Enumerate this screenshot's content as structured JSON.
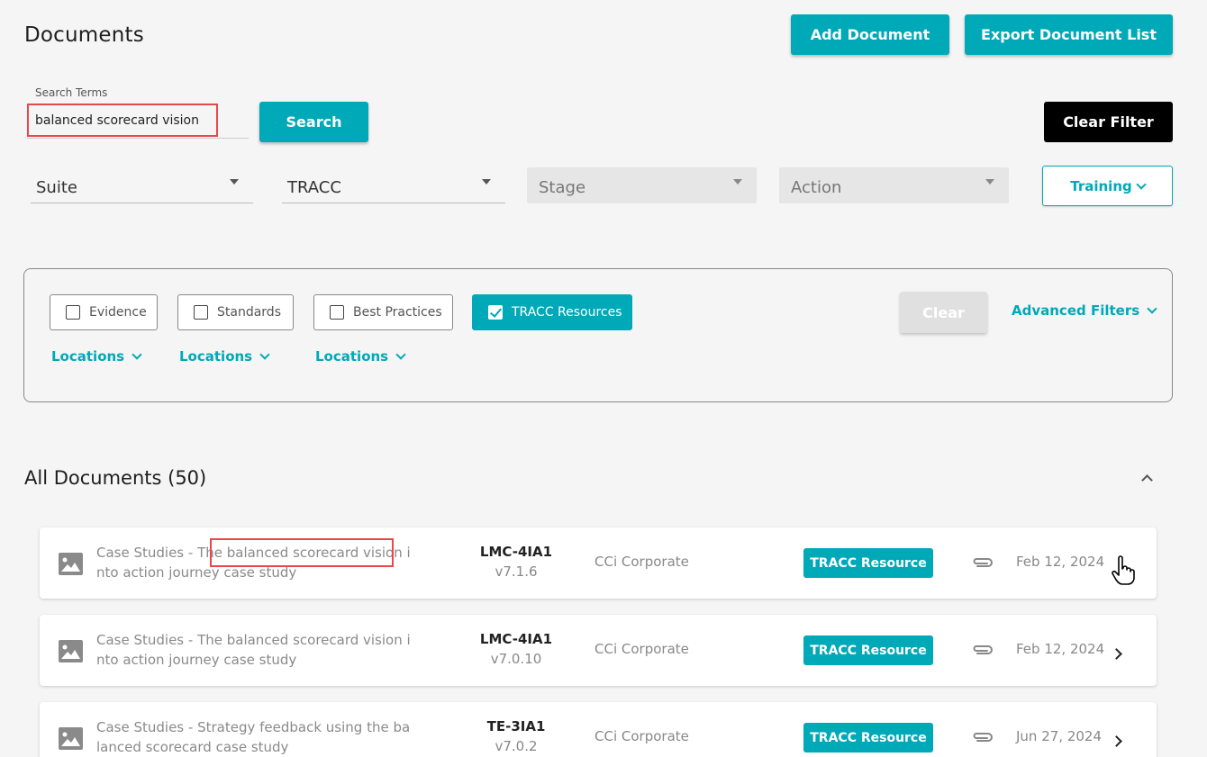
{
  "page": {
    "title": "Documents",
    "add_label": "Add Document",
    "export_label": "Export Document List"
  },
  "search": {
    "label": "Search Terms",
    "value": "balanced scorecard vision",
    "button_label": "Search",
    "clear_filter_label": "Clear Filter"
  },
  "selects": {
    "suite": "Suite",
    "tracc": "TRACC",
    "stage": "Stage",
    "action": "Action",
    "training_label": "Training"
  },
  "filters": {
    "evidence": "Evidence",
    "standards": "Standards",
    "best_practices": "Best Practices",
    "tracc_resources": "TRACC Resources",
    "locations": "Locations",
    "clear_label": "Clear",
    "advanced_label": "Advanced Filters"
  },
  "list": {
    "heading": "All Documents (50)",
    "items": [
      {
        "title": "Case Studies - The balanced scorecard vision into action journey case study",
        "code": "LMC-4IA1",
        "version": "v7.1.6",
        "org": "CCi Corporate",
        "badge": "TRACC Resource",
        "date": "Feb 12, 2024"
      },
      {
        "title": "Case Studies - The balanced scorecard vision into action journey case study",
        "code": "LMC-4IA1",
        "version": "v7.0.10",
        "org": "CCi Corporate",
        "badge": "TRACC Resource",
        "date": "Feb 12, 2024"
      },
      {
        "title": "Case Studies - Strategy feedback using the balanced scorecard case study",
        "code": "TE-3IA1",
        "version": "v7.0.2",
        "org": "CCi Corporate",
        "badge": "TRACC Resource",
        "date": "Jun 27, 2024"
      }
    ]
  },
  "colors": {
    "accent": "#00a9b8",
    "highlight": "#e8474b"
  }
}
